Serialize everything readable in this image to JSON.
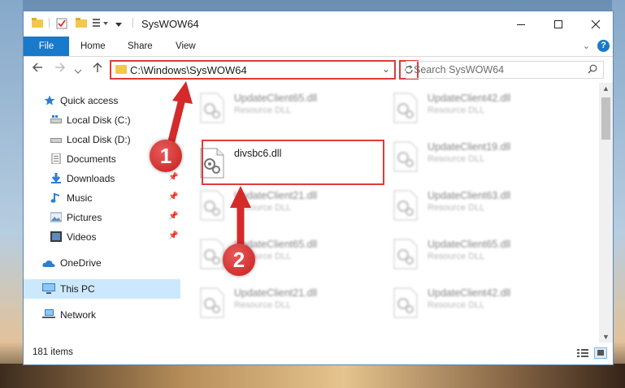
{
  "window": {
    "title": "SysWOW64"
  },
  "ribbon": {
    "tabs": [
      "File",
      "Home",
      "Share",
      "View"
    ]
  },
  "address": {
    "path": "C:\\Windows\\SysWOW64"
  },
  "search": {
    "placeholder": "Search SysWOW64"
  },
  "sidebar": {
    "items": [
      {
        "label": "Quick access",
        "icon": "star-icon",
        "pinned": false
      },
      {
        "label": "Local Disk (C:)",
        "icon": "drive-icon",
        "pinned": true
      },
      {
        "label": "Local Disk (D:)",
        "icon": "drive-icon",
        "pinned": true
      },
      {
        "label": "Documents",
        "icon": "documents-icon",
        "pinned": true
      },
      {
        "label": "Downloads",
        "icon": "download-icon",
        "pinned": true
      },
      {
        "label": "Music",
        "icon": "music-icon",
        "pinned": true
      },
      {
        "label": "Pictures",
        "icon": "pictures-icon",
        "pinned": true
      },
      {
        "label": "Videos",
        "icon": "videos-icon",
        "pinned": true
      },
      {
        "label": "OneDrive",
        "icon": "cloud-icon",
        "pinned": false
      },
      {
        "label": "This PC",
        "icon": "computer-icon",
        "pinned": false,
        "selected": true
      },
      {
        "label": "Network",
        "icon": "network-icon",
        "pinned": false
      }
    ]
  },
  "files": [
    {
      "name": "UpdateClient65.dll",
      "type": "Resource DLL"
    },
    {
      "name": "UpdateClient42.dll",
      "type": "Resource DLL"
    },
    {
      "name": "divsbc6.dll",
      "type": ""
    },
    {
      "name": "UpdateClient19.dll",
      "type": "Resource DLL"
    },
    {
      "name": "UpdateClient21.dll",
      "type": "Resource DLL"
    },
    {
      "name": "UpdateClient63.dll",
      "type": "Resource DLL"
    },
    {
      "name": "UpdateClient65.dll",
      "type": "Resource DLL"
    },
    {
      "name": "UpdateClient65.dll",
      "type": "Resource DLL"
    },
    {
      "name": "UpdateClient21.dll",
      "type": "Resource DLL"
    },
    {
      "name": "UpdateClient42.dll",
      "type": "Resource DLL"
    }
  ],
  "status": {
    "item_count": "181 items"
  },
  "markers": [
    "1",
    "2"
  ],
  "colors": {
    "accent": "#1979ca",
    "highlight": "#e03a3a",
    "selected_bg": "#cce8ff"
  }
}
